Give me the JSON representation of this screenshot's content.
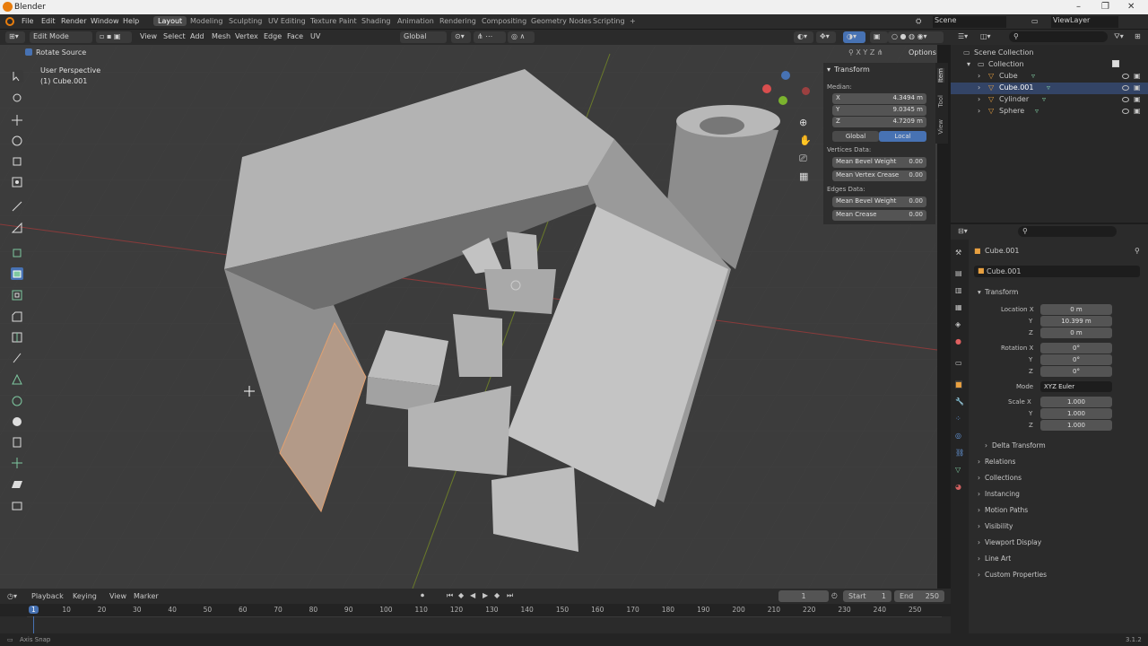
{
  "window": {
    "title": "Blender",
    "controls": [
      "–",
      "❐",
      "✕"
    ]
  },
  "menu": [
    "File",
    "Edit",
    "Render",
    "Window",
    "Help"
  ],
  "workspaces": [
    "Layout",
    "Modeling",
    "Sculpting",
    "UV Editing",
    "Texture Paint",
    "Shading",
    "Animation",
    "Rendering",
    "Compositing",
    "Geometry Nodes",
    "Scripting",
    "+"
  ],
  "active_workspace": "Layout",
  "scene": "Scene",
  "view_layer": "ViewLayer",
  "header3d": {
    "mode": "Edit Mode",
    "menus": [
      "View",
      "Select",
      "Add",
      "Mesh",
      "Vertex",
      "Edge",
      "Face",
      "UV"
    ],
    "orientation": "Global",
    "options": "Options"
  },
  "viewport": {
    "rotate_source": "Rotate Source",
    "perspective": "User Perspective",
    "object_label": "(1) Cube.001"
  },
  "npanel": {
    "title": "Transform",
    "median": "Median:",
    "x_label": "X",
    "x_val": "4.3494 m",
    "y_label": "Y",
    "y_val": "9.0345 m",
    "z_label": "Z",
    "z_val": "4.7209 m",
    "global": "Global",
    "local": "Local",
    "vertices_data": "Vertices Data:",
    "mbw_label": "Mean Bevel Weight",
    "mbw_val": "0.00",
    "mvc_label": "Mean Vertex Crease",
    "mvc_val": "0.00",
    "edges_data": "Edges Data:",
    "mbw2_label": "Mean Bevel Weight",
    "mbw2_val": "0.00",
    "mc_label": "Mean Crease",
    "mc_val": "0.00",
    "tabs": [
      "Item",
      "Tool",
      "View"
    ]
  },
  "outliner": {
    "root": "Scene Collection",
    "collection": "Collection",
    "items": [
      "Cube",
      "Cube.001",
      "Cylinder",
      "Sphere"
    ],
    "selected": "Cube.001"
  },
  "properties": {
    "object": "Cube.001",
    "data_name": "Cube.001",
    "transform": "Transform",
    "loc_label": "Location X",
    "loc_x": "0 m",
    "loc_y": "10.399 m",
    "loc_z": "0 m",
    "rot_label": "Rotation X",
    "rot_x": "0°",
    "rot_y": "0°",
    "rot_z": "0°",
    "mode_label": "Mode",
    "mode_val": "XYZ Euler",
    "scale_label": "Scale X",
    "scale_x": "1.000",
    "scale_y": "1.000",
    "scale_z": "1.000",
    "y": "Y",
    "z": "Z",
    "delta": "Delta Transform",
    "sections": [
      "Relations",
      "Collections",
      "Instancing",
      "Motion Paths",
      "Visibility",
      "Viewport Display",
      "Line Art",
      "Custom Properties"
    ]
  },
  "timeline": {
    "menus": [
      "Playback",
      "Keying",
      "View",
      "Marker"
    ],
    "current_frame": "1",
    "start_label": "Start",
    "start": "1",
    "end_label": "End",
    "end": "250",
    "ticks": [
      "1",
      "10",
      "20",
      "30",
      "40",
      "50",
      "60",
      "70",
      "80",
      "90",
      "100",
      "110",
      "120",
      "130",
      "140",
      "150",
      "160",
      "170",
      "180",
      "190",
      "200",
      "210",
      "220",
      "230",
      "240",
      "250"
    ]
  },
  "status": {
    "left": "Axis Snap",
    "version": "3.1.2"
  },
  "colors": {
    "accent": "#4772b3",
    "selected_face": "#b39a88",
    "bg": "#3b3b3b"
  }
}
